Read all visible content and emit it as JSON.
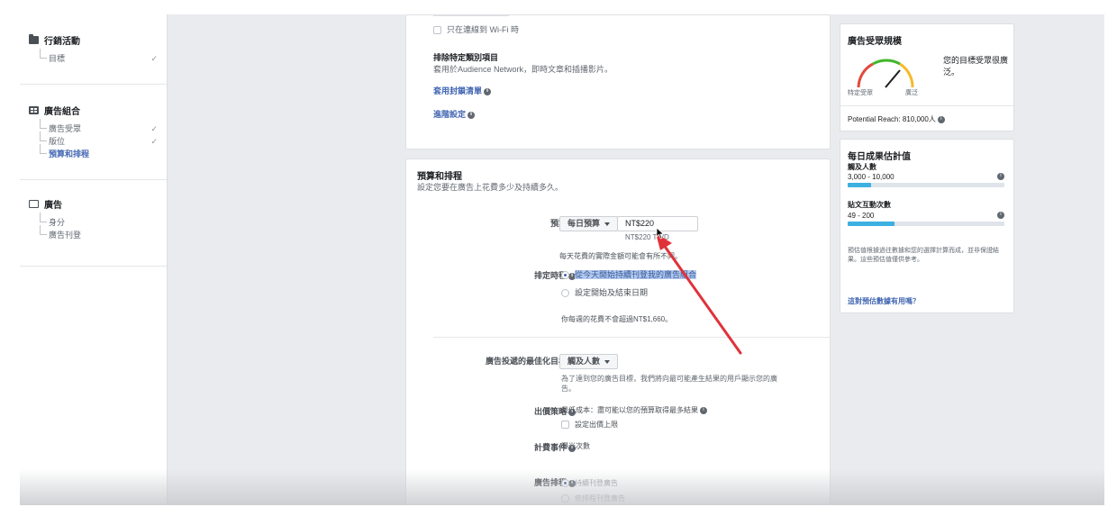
{
  "left_nav": {
    "campaign": {
      "title": "行銷活動",
      "items": [
        {
          "label": "目標",
          "check": "✓"
        }
      ]
    },
    "adset": {
      "title": "廣告組合",
      "items": [
        {
          "label": "廣告受眾",
          "check": "✓"
        },
        {
          "label": "版位",
          "check": "✓"
        },
        {
          "label": "預算和排程",
          "check": ""
        }
      ]
    },
    "ad": {
      "title": "廣告",
      "items": [
        {
          "label": "身分"
        },
        {
          "label": "廣告刊登"
        }
      ]
    }
  },
  "placements_card": {
    "only_connected": "只在連線到 Wi-Fi 時",
    "exclude_title": "排除特定類別項目",
    "exclude_desc": "套用於Audience Network，即時文章和插播影片。",
    "apply_block_list": "套用封鎖清單",
    "view_more": "進階設定"
  },
  "budget": {
    "section_title": "預算和排程",
    "section_desc": "設定您要在廣告上花費多少及持續多久。",
    "budget_label": "預算",
    "budget_type": "每日預算",
    "budget_value": "NT$220",
    "budget_converted": "NT$220 TWD",
    "budget_note": "每天花費的實際金額可能會有所不同。",
    "schedule_label": "排定時程",
    "schedule_option_1": "從今天開始持續刊登我的廣告組合",
    "schedule_option_2": "設定開始及結束日期",
    "weekly_note": "你每週的花費不會超過NT$1,660。",
    "optimization_label": "廣告投遞的最佳化目標",
    "optimization_value": "觸及人數",
    "optimization_desc": "為了達到您的廣告目標，我們將向最可能產生結果的用戶顯示您的廣告。",
    "bid_label": "出價策略",
    "bid_value": "最低成本：盡可能以您的預算取得最多結果",
    "bid_cap": "設定出價上限",
    "charge_label": "計費事件",
    "charge_value": "曝光次數",
    "ad_schedule_label": "廣告排程",
    "ad_schedule_opt1": "持續刊登廣告",
    "ad_schedule_opt2": "依排程刊登廣告"
  },
  "audience_card": {
    "title": "廣告受眾規模",
    "desc": "您的目標受眾很廣泛。",
    "specific": "特定受眾",
    "broad": "廣泛",
    "potential_reach": "Potential Reach: 810,000人"
  },
  "daily_card": {
    "title": "每日成果估計值",
    "reach_label": "觸及人數",
    "reach_value": "3,000 - 10,000",
    "reach_fraction": 0.15,
    "engagement_label": "貼文互動次數",
    "engagement_value": "49 - 200",
    "engagement_fraction": 0.3,
    "note": "預估值根據過往數據和您的選擇計算而成，並非保證結果。這些預估值僅供參考。",
    "link": "這對預估數據有用嗎？"
  },
  "colors": {
    "accent": "#4267b2",
    "bar": "#3cb0e0",
    "arrow": "#e0323a"
  }
}
